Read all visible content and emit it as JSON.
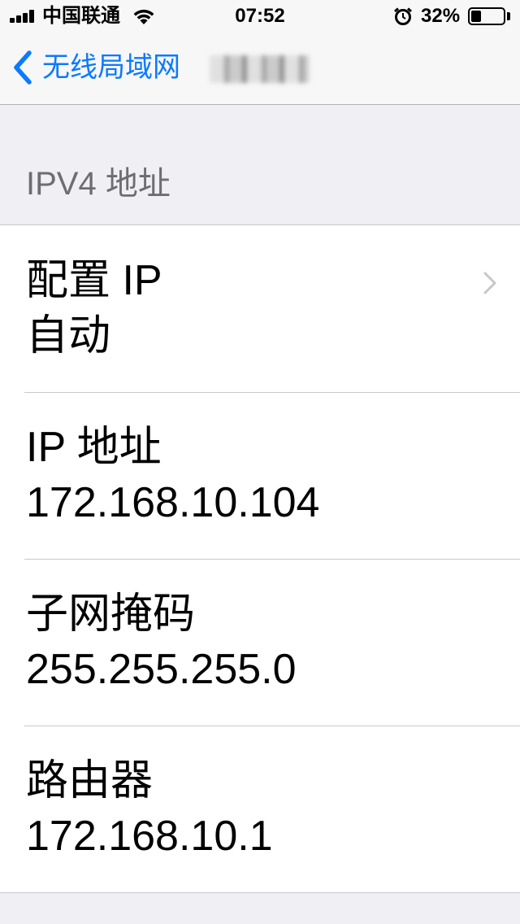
{
  "status_bar": {
    "carrier": "中国联通",
    "time": "07:52",
    "battery_percent_label": "32%",
    "battery_level": 0.32,
    "icons": [
      "signal-icon",
      "wifi-icon",
      "alarm-icon",
      "battery-icon"
    ]
  },
  "nav": {
    "back_label": "无线局域网",
    "back_icon": "chevron-left-icon",
    "title": ""
  },
  "section": {
    "header": "IPV4 地址"
  },
  "cells": [
    {
      "label": "配置 IP",
      "value": "自动",
      "has_chevron": true
    },
    {
      "label": "IP 地址",
      "value": "172.168.10.104"
    },
    {
      "label": "子网掩码",
      "value": "255.255.255.0"
    },
    {
      "label": "路由器",
      "value": "172.168.10.1"
    }
  ],
  "colors": {
    "accent": "#0a7aff",
    "background": "#efeff4",
    "section_text": "#6d6d72",
    "separator": "#c8c7cc"
  }
}
